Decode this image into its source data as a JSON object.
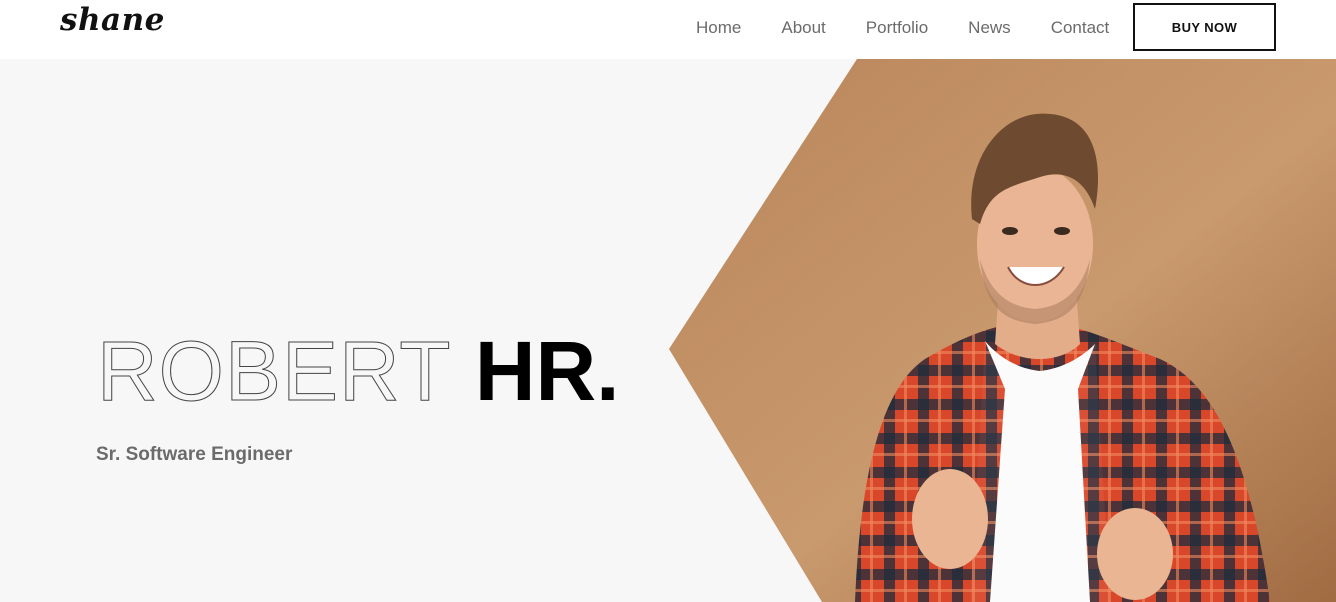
{
  "brand": {
    "logo_text": "shane"
  },
  "nav": {
    "links": [
      {
        "label": "Home"
      },
      {
        "label": "About"
      },
      {
        "label": "Portfolio"
      },
      {
        "label": "News"
      },
      {
        "label": "Contact"
      }
    ],
    "cta_label": "BUY NOW"
  },
  "hero": {
    "title_outline": "ROBERT",
    "title_solid": "HR.",
    "subtitle": "Sr. Software Engineer",
    "photo_icon": "person-photo",
    "colors": {
      "backdrop": "#b78357",
      "shirt_red": "#d9472b",
      "shirt_dark": "#1f2b3a",
      "background": "#f7f7f7"
    }
  }
}
